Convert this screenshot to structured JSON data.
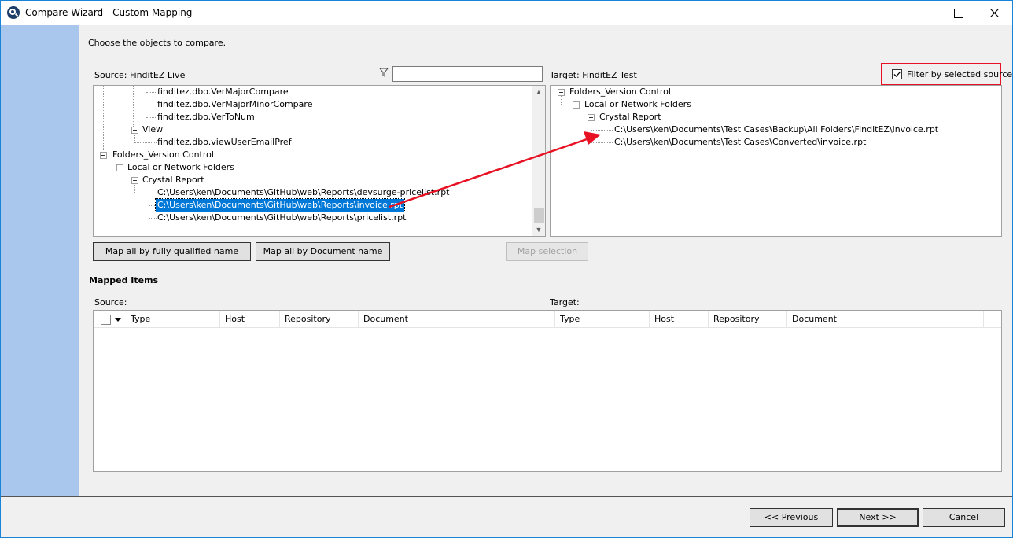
{
  "window": {
    "title": "Compare Wizard - Custom Mapping"
  },
  "instructions": "Choose the objects to compare.",
  "source": {
    "label": "Source: FinditEZ Live",
    "filter_value": "",
    "tree": [
      {
        "label": "finditez.dbo.VerMajorCompare"
      },
      {
        "label": "finditez.dbo.VerMajorMinorCompare"
      },
      {
        "label": "finditez.dbo.VerToNum"
      },
      {
        "label": "View"
      },
      {
        "label": "finditez.dbo.viewUserEmailPref"
      },
      {
        "label": "Folders_Version Control"
      },
      {
        "label": "Local or Network Folders"
      },
      {
        "label": "Crystal Report"
      },
      {
        "label": "C:\\Users\\ken\\Documents\\GitHub\\web\\Reports\\devsurge-pricelist.rpt"
      },
      {
        "label": "C:\\Users\\ken\\Documents\\GitHub\\web\\Reports\\invoice.rpt"
      },
      {
        "label": "C:\\Users\\ken\\Documents\\GitHub\\web\\Reports\\pricelist.rpt"
      }
    ]
  },
  "target": {
    "label": "Target: FinditEZ Test",
    "filter_checkbox_label": "Filter by selected source",
    "filter_checked": true,
    "tree": [
      {
        "label": "Folders_Version Control"
      },
      {
        "label": "Local or Network Folders"
      },
      {
        "label": "Crystal Report"
      },
      {
        "label": "C:\\Users\\ken\\Documents\\Test Cases\\Backup\\All Folders\\FinditEZ\\invoice.rpt"
      },
      {
        "label": "C:\\Users\\ken\\Documents\\Test Cases\\Converted\\invoice.rpt"
      }
    ]
  },
  "buttons": {
    "map_fqn": "Map all by fully qualified name",
    "map_docname": "Map all by Document name",
    "map_selection": "Map selection"
  },
  "mapped": {
    "title": "Mapped Items",
    "source_label": "Source:",
    "target_label": "Target:",
    "columns": [
      "Type",
      "Host",
      "Repository",
      "Document",
      "Type",
      "Host",
      "Repository",
      "Document"
    ]
  },
  "footer": {
    "previous": "<< Previous",
    "next": "Next >>",
    "cancel": "Cancel"
  },
  "colors": {
    "accent": "#0078d7",
    "left_band": "#a9c6ec",
    "highlight": "#e81123"
  }
}
